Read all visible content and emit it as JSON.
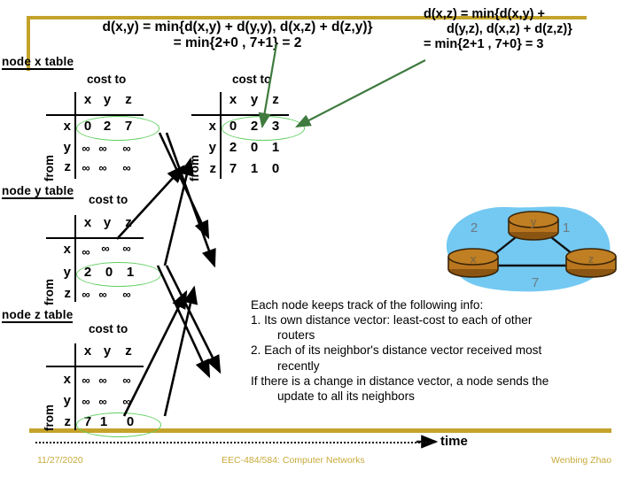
{
  "slide": {
    "formula_left": {
      "line1": "d(x,y) = min{d(x,y) + d(y,y), d(x,z) + d(z,y)}",
      "line2": "= min{2+0 , 7+1} = 2"
    },
    "formula_right": {
      "line1": "d(x,z)   =   min{d(x,y)   +",
      "line2": "d(y,z), d(x,z) + d(z,z)}",
      "line3": "= min{2+1 , 7+0} = 3"
    },
    "accent_color": "#c4a32a",
    "highlight_color": "#5fcf5f",
    "arrow_color": "#000000",
    "cloud_color": "#73c9f2",
    "router_color": "#b9761f"
  },
  "tables": [
    {
      "title": "node x table",
      "header_label": "cost to",
      "row_axis_label": "from",
      "columns": [
        "x",
        "y",
        "z"
      ],
      "rows": [
        {
          "label": "x",
          "values": [
            "0",
            "2",
            "7"
          ]
        },
        {
          "label": "y",
          "values": [
            "∞",
            "∞",
            "∞"
          ]
        },
        {
          "label": "z",
          "values": [
            "∞",
            "∞",
            "∞"
          ]
        }
      ],
      "highlighted_row": "x"
    },
    {
      "title": "",
      "header_label": "cost to",
      "row_axis_label": "from",
      "columns": [
        "x",
        "y",
        "z"
      ],
      "rows": [
        {
          "label": "x",
          "values": [
            "0",
            "2",
            "3"
          ]
        },
        {
          "label": "y",
          "values": [
            "2",
            "0",
            "1"
          ]
        },
        {
          "label": "z",
          "values": [
            "7",
            "1",
            "0"
          ]
        }
      ],
      "highlighted_row": "x"
    },
    {
      "title": "node y table",
      "header_label": "cost to",
      "row_axis_label": "from",
      "columns": [
        "x",
        "y",
        "z"
      ],
      "rows": [
        {
          "label": "x",
          "values": [
            "∞",
            "∞",
            "∞"
          ]
        },
        {
          "label": "y",
          "values": [
            "2",
            "0",
            "1"
          ]
        },
        {
          "label": "z",
          "values": [
            "∞",
            "∞",
            "∞"
          ]
        }
      ],
      "highlighted_row": "y"
    },
    {
      "title": "node z table",
      "header_label": "cost to",
      "row_axis_label": "from",
      "columns": [
        "x",
        "y",
        "z"
      ],
      "rows": [
        {
          "label": "x",
          "values": [
            "∞",
            "∞",
            "∞"
          ]
        },
        {
          "label": "y",
          "values": [
            "∞",
            "∞",
            "∞"
          ]
        },
        {
          "label": "z",
          "values": [
            "7",
            "1",
            "0"
          ]
        }
      ],
      "highlighted_row": "z"
    }
  ],
  "topology": {
    "nodes": [
      {
        "id": "x",
        "label": "x"
      },
      {
        "id": "y",
        "label": "y"
      },
      {
        "id": "z",
        "label": "z"
      }
    ],
    "links": [
      {
        "from": "x",
        "to": "y",
        "cost": "2"
      },
      {
        "from": "y",
        "to": "z",
        "cost": "1"
      },
      {
        "from": "x",
        "to": "z",
        "cost": "7"
      }
    ]
  },
  "notes": {
    "lead": "Each node keeps track of the following info:",
    "item1": "1. Its  own  distance  vector:  least-cost  to  each  of  other",
    "item1_cont": "routers",
    "item2": "2. Each  of  its  neighbor's  distance  vector  received  most",
    "item2_cont": "recently",
    "tail1": "If there is a change in distance vector, a node sends the",
    "tail2": "update to all its neighbors"
  },
  "time_axis": {
    "label": "time"
  },
  "footer": {
    "date": "11/27/2020",
    "course": "EEC-484/584: Computer Networks",
    "author": "Wenbing Zhao"
  }
}
